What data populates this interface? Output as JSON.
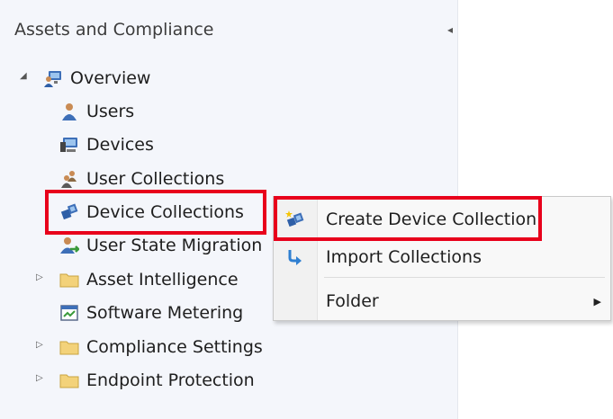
{
  "pane": {
    "title": "Assets and Compliance",
    "collapse_glyph": "◂"
  },
  "tree": {
    "root": {
      "label": "Overview",
      "icon": "overview-icon",
      "expander": "◢"
    },
    "items": [
      {
        "label": "Users",
        "icon": "users-icon"
      },
      {
        "label": "Devices",
        "icon": "devices-icon"
      },
      {
        "label": "User Collections",
        "icon": "user-collections-icon"
      },
      {
        "label": "Device Collections",
        "icon": "device-collections-icon"
      },
      {
        "label": "User State Migration",
        "icon": "user-state-migration-icon"
      },
      {
        "label": "Asset Intelligence",
        "icon": "folder-icon",
        "expander": "▷"
      },
      {
        "label": "Software Metering",
        "icon": "software-metering-icon"
      },
      {
        "label": "Compliance Settings",
        "icon": "folder-icon",
        "expander": "▷"
      },
      {
        "label": "Endpoint Protection",
        "icon": "folder-icon",
        "expander": "▷"
      }
    ]
  },
  "context_menu": {
    "items": [
      {
        "label": "Create Device Collection",
        "icon": "create-device-collection-icon"
      },
      {
        "label": "Import Collections",
        "icon": "import-arrow-icon"
      },
      {
        "label": "Folder",
        "submenu_glyph": "▶"
      }
    ]
  },
  "colors": {
    "highlight_border": "#e8001b",
    "pane_background": "#f4f6fb"
  }
}
